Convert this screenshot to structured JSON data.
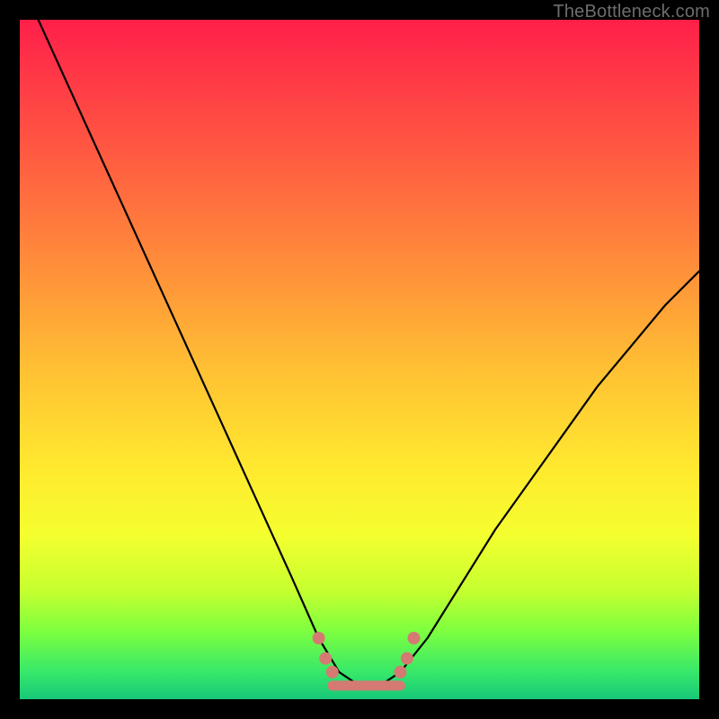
{
  "attribution": "TheBottleneck.com",
  "colors": {
    "frame": "#000000",
    "curve": "#000000",
    "marker": "#d47a72",
    "gradient_stops": [
      "#ff1f4a",
      "#ff5542",
      "#ff8d3a",
      "#ffc233",
      "#ffe92f",
      "#f4ff2f",
      "#c6ff2f",
      "#7dff3f",
      "#37e86a",
      "#17c778"
    ]
  },
  "chart_data": {
    "type": "line",
    "title": "",
    "xlabel": "",
    "ylabel": "",
    "xlim": [
      0,
      100
    ],
    "ylim": [
      0,
      100
    ],
    "grid": false,
    "legend": false,
    "series": [
      {
        "name": "curve",
        "x": [
          0,
          5,
          10,
          15,
          20,
          25,
          30,
          35,
          40,
          44,
          47,
          50,
          53,
          56,
          60,
          65,
          70,
          75,
          80,
          85,
          90,
          95,
          100
        ],
        "y": [
          106,
          95,
          84,
          73,
          62,
          51,
          40,
          29,
          18,
          9,
          4,
          2,
          2,
          4,
          9,
          17,
          25,
          32,
          39,
          46,
          52,
          58,
          63
        ]
      }
    ],
    "markers": {
      "name": "highlight",
      "color": "#d47a72",
      "points": [
        {
          "x": 44,
          "y": 9
        },
        {
          "x": 45,
          "y": 6
        },
        {
          "x": 46,
          "y": 4
        },
        {
          "x": 56,
          "y": 4
        },
        {
          "x": 57,
          "y": 6
        },
        {
          "x": 58,
          "y": 9
        }
      ],
      "flat_segment": {
        "x0": 46,
        "x1": 56,
        "y": 2
      }
    }
  }
}
